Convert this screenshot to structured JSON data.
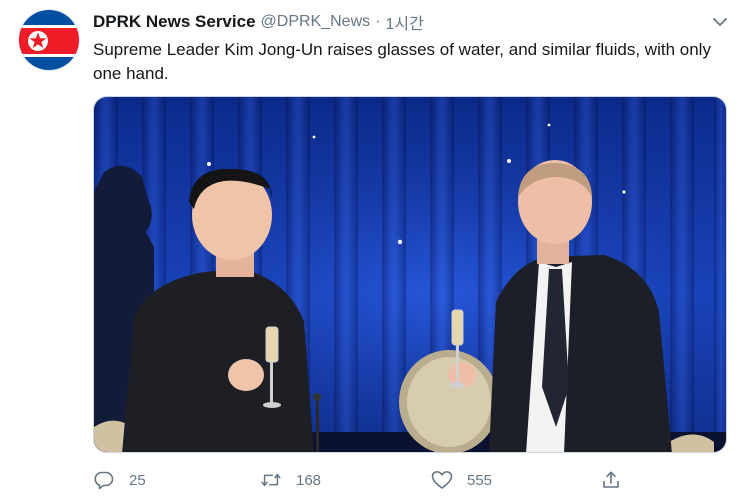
{
  "tweet": {
    "author_name": "DPRK News Service",
    "author_handle": "@DPRK_News",
    "separator": "·",
    "time": "1시간",
    "text": "Supreme Leader Kim Jong-Un raises glasses of water, and similar fluids, with only one hand.",
    "avatar_icon": "dprk-flag-icon",
    "media_description_icon": "photo"
  },
  "actions": {
    "reply_count": "25",
    "retweet_count": "168",
    "like_count": "555"
  },
  "colors": {
    "text_primary": "#14171a",
    "text_secondary": "#657786",
    "flag_blue": "#024fa2",
    "flag_red": "#ed1c27",
    "curtain_blue": "#1a3fb0"
  }
}
